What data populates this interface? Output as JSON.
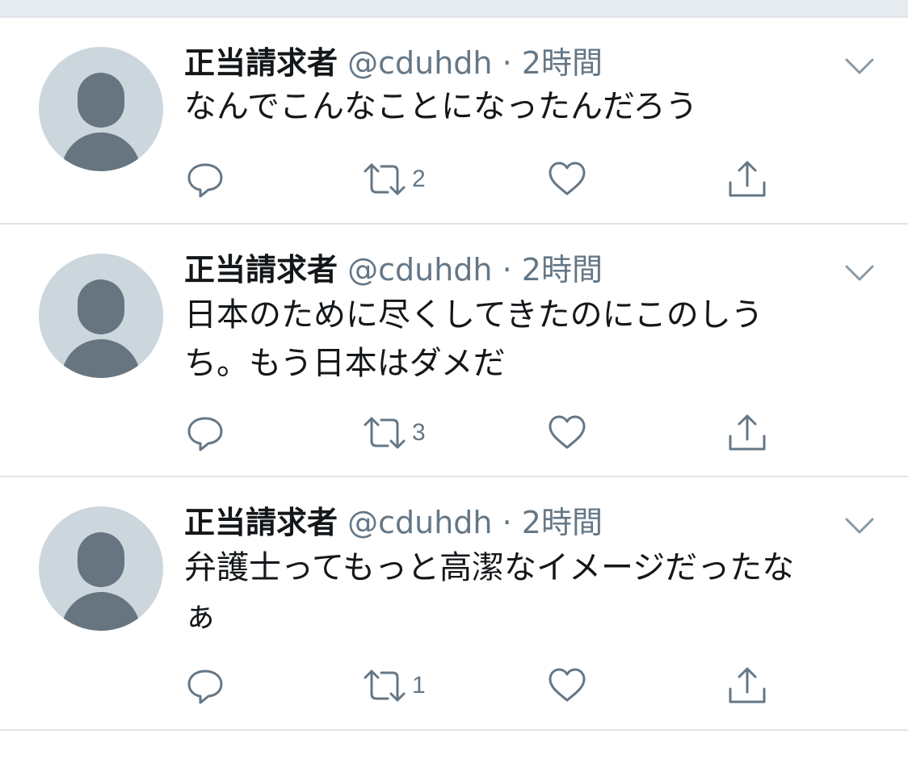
{
  "tweets": [
    {
      "name": "正当請求者",
      "handle": "@cduhdh",
      "separator": "·",
      "time": "2時間",
      "text": "なんでこんなことになったんだろう",
      "reply_count": "",
      "retweet_count": "2",
      "like_count": ""
    },
    {
      "name": "正当請求者",
      "handle": "@cduhdh",
      "separator": "·",
      "time": "2時間",
      "text": "日本のために尽くしてきたのにこのしう\nち。もう日本はダメだ",
      "reply_count": "",
      "retweet_count": "3",
      "like_count": ""
    },
    {
      "name": "正当請求者",
      "handle": "@cduhdh",
      "separator": "·",
      "time": "2時間",
      "text": "弁護士ってもっと高潔なイメージだったな\nぁ",
      "reply_count": "",
      "retweet_count": "1",
      "like_count": ""
    }
  ],
  "icons": {
    "reply": "reply-icon",
    "retweet": "retweet-icon",
    "like": "heart-icon",
    "share": "share-icon",
    "caret": "chevron-down-icon",
    "avatar": "default-avatar"
  },
  "colors": {
    "primary_text": "#14171a",
    "secondary_text": "#657786",
    "avatar_bg": "#ccd6dd",
    "avatar_fg": "#66757f",
    "divider": "#dfe5ea"
  }
}
